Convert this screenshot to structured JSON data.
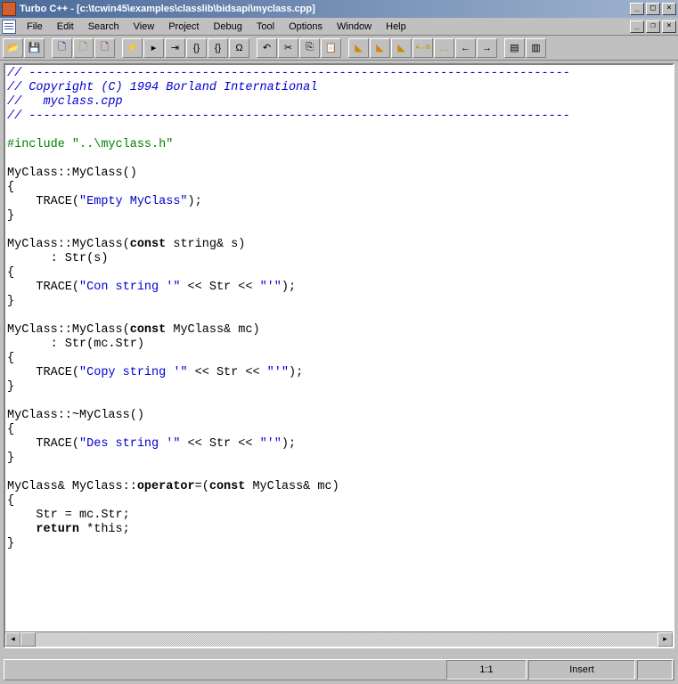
{
  "title": "Turbo C++ - [c:\\tcwin45\\examples\\classlib\\bidsapi\\myclass.cpp]",
  "menu": [
    "File",
    "Edit",
    "Search",
    "View",
    "Project",
    "Debug",
    "Tool",
    "Options",
    "Window",
    "Help"
  ],
  "toolbar_icons": [
    "open-file",
    "save-file",
    "find-a",
    "find-b",
    "find-c",
    "lightning",
    "step-into",
    "run-to",
    "breakpoint-1",
    "breakpoint-2",
    "breakpoint-omega",
    "undo",
    "cut",
    "copy",
    "paste",
    "highlight-1",
    "highlight-2",
    "highlight-3",
    "highlight-ab",
    "highlight-dots",
    "goto-left",
    "goto-right",
    "view-split",
    "view-single"
  ],
  "status": {
    "pos": "1:1",
    "mode": "Insert"
  },
  "comment_dash": "// ---------------------------------------------------------------------------",
  "code": {
    "l1": "// Copyright (C) 1994 Borland International",
    "l2": "//   myclass.cpp",
    "inc1": "#include \"..\\myclass.h\"",
    "c1": "MyClass::MyClass()",
    "c1b": "    TRACE(",
    "c1s": "\"Empty MyClass\"",
    "c1e": ");",
    "c2": "MyClass::MyClass(",
    "c2k": "const",
    "c2r": " string& s)",
    "c2i": "      : Str(s)",
    "c2t": "    TRACE(",
    "c2s": "\"Con string '\"",
    "c2m": " << Str << ",
    "c2s2": "\"'\"",
    "c2e": ");",
    "c3": "MyClass::MyClass(",
    "c3r": " MyClass& mc)",
    "c3i": "      : Str(mc.Str)",
    "c3t": "    TRACE(",
    "c3s": "\"Copy string '\"",
    "c4": "MyClass::~MyClass()",
    "c4t": "    TRACE(",
    "c4s": "\"Des string '\"",
    "c5a": "MyClass& MyClass::",
    "c5op": "operator",
    "c5b": "=(",
    "c5r": " MyClass& mc)",
    "c5s1": "    Str = mc.Str;",
    "c5s2": "    ",
    "c5ret": "return",
    "c5s3": " *this;",
    "ob": "{",
    "cb": "}"
  }
}
